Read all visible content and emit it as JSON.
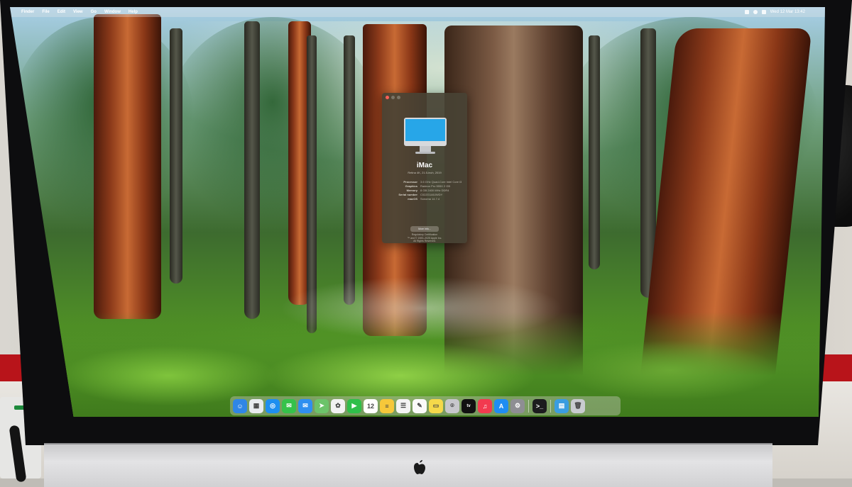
{
  "menubar": {
    "apple_symbol": "",
    "items": [
      "Finder",
      "File",
      "Edit",
      "View",
      "Go",
      "Window",
      "Help"
    ],
    "clock": "Wed 12 Mar  13:42"
  },
  "about_window": {
    "title": "iMac",
    "subtitle": "Retina 4K, 21.5-inch, 2019",
    "specs": [
      {
        "key": "Processor",
        "value": "3.6 GHz Quad-Core Intel Core i3"
      },
      {
        "key": "Graphics",
        "value": "Radeon Pro 555X 2 GB"
      },
      {
        "key": "Memory",
        "value": "8 GB 2400 MHz DDR4"
      },
      {
        "key": "Serial number",
        "value": "C02ZG1A0JWDY"
      },
      {
        "key": "macOS",
        "value": "Sonoma 14.7.4"
      }
    ],
    "more_info_label": "More Info...",
    "footer": "Regulatory Certification\n™ and © 1983–2025 Apple Inc.\nAll Rights Reserved."
  },
  "dock": {
    "apps": [
      {
        "name": "finder-icon",
        "color": "#2f86e6",
        "glyph": "☺"
      },
      {
        "name": "launchpad-icon",
        "color": "#e9ecef",
        "glyph": "▦"
      },
      {
        "name": "safari-icon",
        "color": "#1e8ff0",
        "glyph": "◎"
      },
      {
        "name": "messages-icon",
        "color": "#35c24a",
        "glyph": "✉"
      },
      {
        "name": "mail-icon",
        "color": "#2f8ff0",
        "glyph": "✉"
      },
      {
        "name": "maps-icon",
        "color": "#6cc36a",
        "glyph": "➤"
      },
      {
        "name": "photos-icon",
        "color": "#f2f2f2",
        "glyph": "✿"
      },
      {
        "name": "facetime-icon",
        "color": "#2fbf4a",
        "glyph": "▶"
      },
      {
        "name": "calendar-icon",
        "color": "#ffffff",
        "glyph": "12"
      },
      {
        "name": "notes-icon",
        "color": "#f6c83a",
        "glyph": "≡"
      },
      {
        "name": "reminders-icon",
        "color": "#f4f4f4",
        "glyph": "☰"
      },
      {
        "name": "freeform-icon",
        "color": "#fafafa",
        "glyph": "✎"
      },
      {
        "name": "stickies-icon",
        "color": "#f5d94a",
        "glyph": "▭"
      },
      {
        "name": "contacts-icon",
        "color": "#c7c7cc",
        "glyph": "⌾"
      },
      {
        "name": "apple-tv-icon",
        "color": "#111111",
        "glyph": "tv"
      },
      {
        "name": "music-icon",
        "color": "#f23a4f",
        "glyph": "♫"
      },
      {
        "name": "app-store-icon",
        "color": "#1f8df2",
        "glyph": "A"
      },
      {
        "name": "system-settings-icon",
        "color": "#8e8e93",
        "glyph": "⚙"
      }
    ],
    "utilities": [
      {
        "name": "terminal-icon",
        "color": "#1c1c1e",
        "glyph": ">_"
      }
    ],
    "right": [
      {
        "name": "downloads-folder-icon",
        "color": "#3a9de0",
        "glyph": "▤"
      },
      {
        "name": "trash-icon",
        "color": "#c9ccd0",
        "glyph": "🗑"
      }
    ]
  },
  "colors": {
    "window_bg": "#484234",
    "menubar_text": "#ffffff",
    "desk_stripe": "#b8141a"
  }
}
